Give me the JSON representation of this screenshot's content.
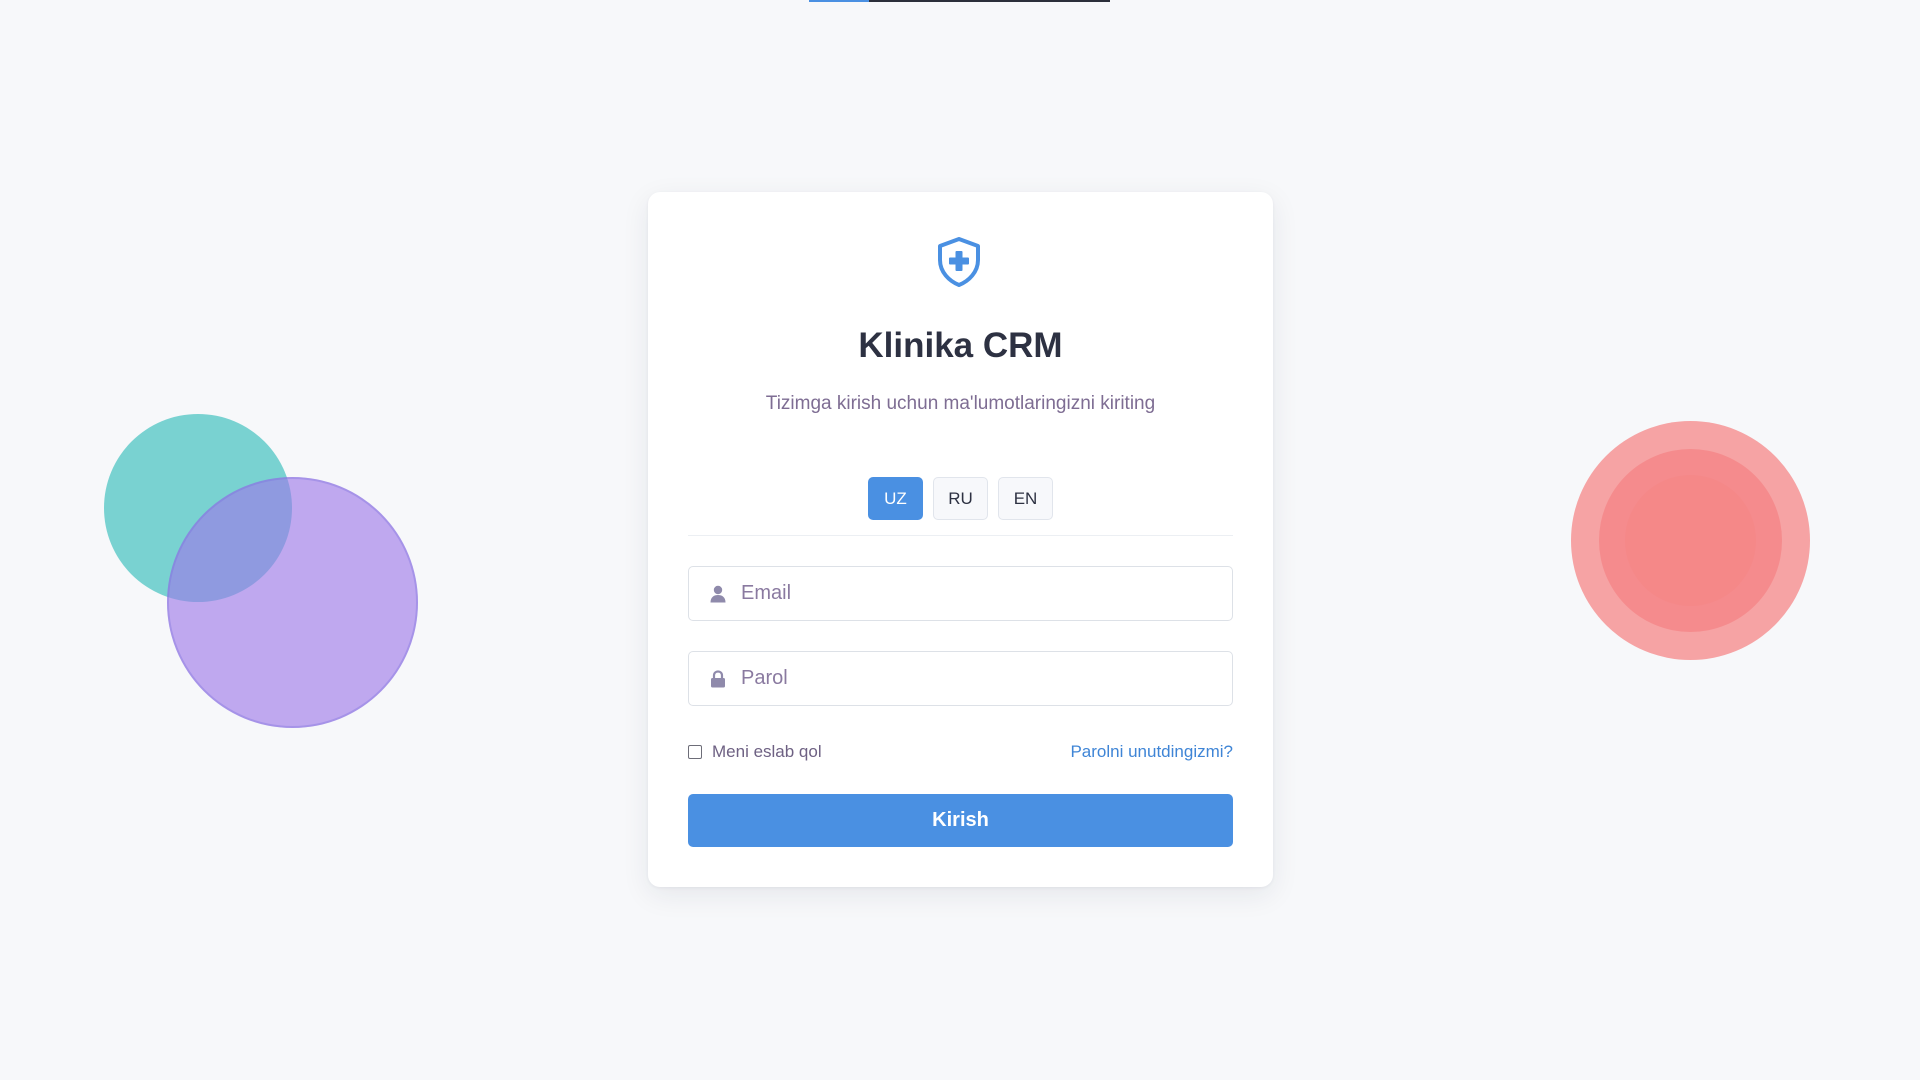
{
  "app": {
    "title": "Klinika CRM",
    "subtitle": "Tizimga kirish uchun ma'lumotlaringizni kiriting",
    "logo_icon": "shield-plus-icon"
  },
  "loading_bar": {
    "progress": 0.2
  },
  "languages": [
    {
      "code": "UZ",
      "active": true
    },
    {
      "code": "RU",
      "active": false
    },
    {
      "code": "EN",
      "active": false
    }
  ],
  "form": {
    "email": {
      "value": "",
      "placeholder": "Email",
      "icon": "user-icon"
    },
    "password": {
      "value": "",
      "placeholder": "Parol",
      "icon": "lock-icon"
    },
    "remember_label": "Meni eslab qol",
    "remember_checked": false,
    "forgot_link": "Parolni unutdingizmi?",
    "submit_label": "Kirish"
  },
  "colors": {
    "accent": "#4a90e2",
    "background": "#f7f8fa",
    "title": "#2d3142",
    "muted_text": "#7e6d93",
    "deco_teal": "#48c4c0",
    "deco_purple": "#9c77e8",
    "deco_red": "#f58282"
  }
}
